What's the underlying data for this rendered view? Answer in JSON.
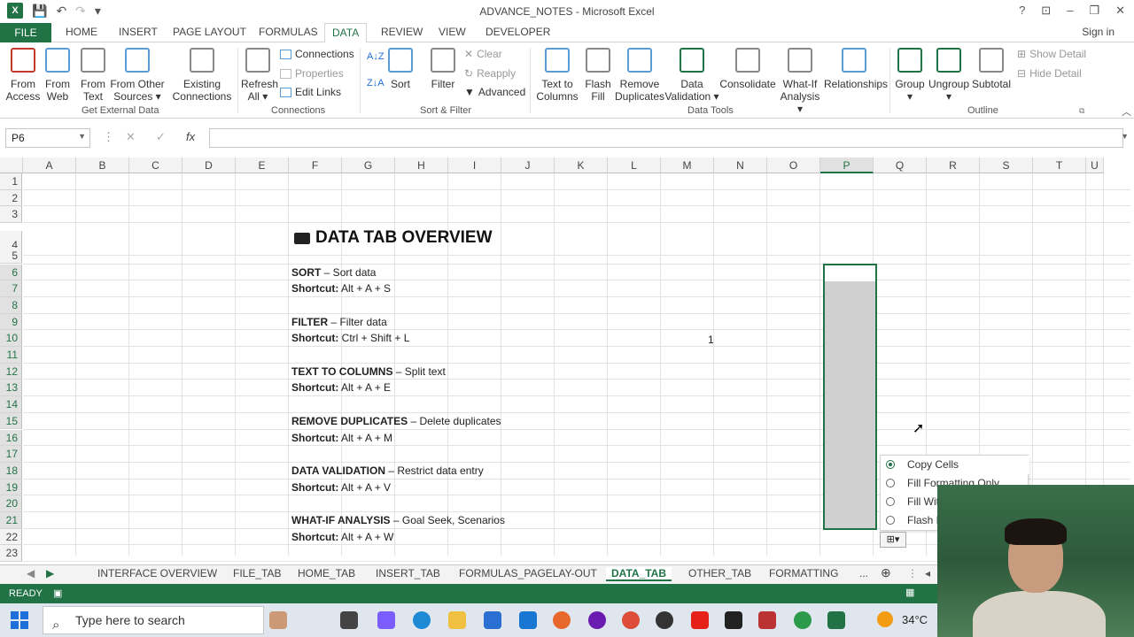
{
  "window": {
    "title": "ADVANCE_NOTES - Microsoft Excel",
    "help": "?",
    "signin": "Sign in"
  },
  "ribbon_tabs": [
    "FILE",
    "HOME",
    "INSERT",
    "PAGE LAYOUT",
    "FORMULAS",
    "DATA",
    "REVIEW",
    "VIEW",
    "DEVELOPER"
  ],
  "active_tab": "DATA",
  "ribbon": {
    "get_external": {
      "from_access": "From\nAccess",
      "from_web": "From\nWeb",
      "from_text": "From\nText",
      "from_other": "From Other\nSources ▾",
      "existing": "Existing\nConnections",
      "label": "Get External Data"
    },
    "connections": {
      "refresh": "Refresh\nAll ▾",
      "connections": "Connections",
      "properties": "Properties",
      "edit_links": "Edit Links",
      "label": "Connections"
    },
    "sort_filter": {
      "sort_az": "A↓Z",
      "sort_za": "Z↓A",
      "sort": "Sort",
      "filter": "Filter",
      "clear": "Clear",
      "reapply": "Reapply",
      "advanced": "Advanced",
      "label": "Sort & Filter"
    },
    "data_tools": {
      "text_to_columns": "Text to\nColumns",
      "flash_fill": "Flash\nFill",
      "remove_duplicates": "Remove\nDuplicates",
      "data_validation": "Data\nValidation ▾",
      "consolidate": "Consolidate",
      "what_if": "What-If\nAnalysis ▾",
      "relationships": "Relationships",
      "label": "Data Tools"
    },
    "outline": {
      "group": "Group\n▾",
      "ungroup": "Ungroup\n▾",
      "subtotal": "Subtotal",
      "show_detail": "Show Detail",
      "hide_detail": "Hide Detail",
      "label": "Outline"
    }
  },
  "formula_bar": {
    "name_box": "P6",
    "fx": "fx",
    "value": ""
  },
  "columns": [
    "A",
    "B",
    "C",
    "D",
    "E",
    "F",
    "G",
    "H",
    "I",
    "J",
    "K",
    "L",
    "M",
    "N",
    "O",
    "P",
    "Q",
    "R",
    "S",
    "T",
    "U"
  ],
  "rows": [
    "1",
    "2",
    "3",
    "4",
    "5",
    "6",
    "7",
    "8",
    "9",
    "10",
    "11",
    "12",
    "13",
    "14",
    "15",
    "16",
    "17",
    "18",
    "19",
    "20",
    "21",
    "22",
    "23"
  ],
  "sheet": {
    "title": "DATA TAB OVERVIEW",
    "entries": [
      {
        "name": "SORT",
        "desc": " – Sort data",
        "shortcut_label": "Shortcut:",
        "shortcut": " Alt + A + S"
      },
      {
        "name": "FILTER",
        "desc": " – Filter data",
        "shortcut_label": "Shortcut:",
        "shortcut": " Ctrl + Shift + L"
      },
      {
        "name": "TEXT TO COLUMNS",
        "desc": " – Split text",
        "shortcut_label": "Shortcut:",
        "shortcut": " Alt + A + E"
      },
      {
        "name": "REMOVE DUPLICATES",
        "desc": " – Delete duplicates",
        "shortcut_label": "Shortcut:",
        "shortcut": " Alt + A + M"
      },
      {
        "name": "DATA VALIDATION",
        "desc": " – Restrict data entry",
        "shortcut_label": "Shortcut:",
        "shortcut": " Alt + A + V"
      },
      {
        "name": "WHAT-IF ANALYSIS",
        "desc": " – Goal Seek, Scenarios",
        "shortcut_label": "Shortcut:",
        "shortcut": " Alt + A + W"
      }
    ],
    "m10_value": "1"
  },
  "autofill_menu": {
    "items": [
      "Copy Cells",
      "Fill Formatting Only",
      "Fill Wit",
      "Flash F"
    ],
    "checked": 0
  },
  "sheet_tabs": [
    "INTERFACE OVERVIEW",
    "FILE_TAB",
    "HOME_TAB",
    "INSERT_TAB",
    "FORMULAS_PAGELAY-OUT",
    "DATA_TAB",
    "OTHER_TAB",
    "FORMATTING",
    "..."
  ],
  "active_sheet": "DATA_TAB",
  "status": {
    "ready": "READY"
  },
  "taskbar": {
    "search_placeholder": "Type here to search",
    "temperature": "34°C"
  },
  "colors": {
    "excel_green": "#217346",
    "selection_gray": "#d0d0d0"
  }
}
